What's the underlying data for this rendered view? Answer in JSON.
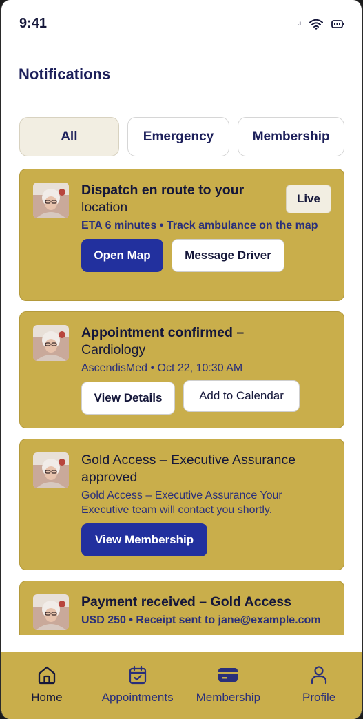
{
  "status_bar": {
    "time": "9:41",
    "signal_text": ".ı"
  },
  "header": {
    "title": "Notifications"
  },
  "tabs": [
    {
      "label": "All",
      "active": true
    },
    {
      "label": "Emergency",
      "active": false
    },
    {
      "label": "Membership",
      "active": false
    }
  ],
  "notifications": [
    {
      "title_bold": "Dispatch en route to your",
      "title_rest": "location",
      "subtitle": "ETA 6 minutes • Track ambulance on the map",
      "badge": "Live",
      "actions": [
        "Open Map",
        "Message Driver"
      ]
    },
    {
      "title_bold": "Appointment confirmed –",
      "title_rest": "Cardiology",
      "subtitle": "AscendisMed • Oct 22, 10:30 AM",
      "actions": [
        "View Details",
        "Add to Calendar"
      ]
    },
    {
      "title": "Gold Access – Executive Assurance approved",
      "subtitle": "Gold Access – Executive Assurance Your Executive team will contact you shortly.",
      "actions": [
        "View Membership"
      ]
    },
    {
      "title_bold": "Payment received – Gold Access",
      "subtitle": "USD 250 • Receipt sent to jane@example.com"
    }
  ],
  "bottom_nav": [
    {
      "label": "Home",
      "icon": "home-icon",
      "active": true
    },
    {
      "label": "Appointments",
      "icon": "calendar-icon",
      "active": false
    },
    {
      "label": "Membership",
      "icon": "card-icon",
      "active": false
    },
    {
      "label": "Profile",
      "icon": "person-icon",
      "active": false
    }
  ],
  "colors": {
    "card_bg": "#c9ae4b",
    "primary": "#22309e",
    "text_dark": "#15173a",
    "text_sub": "#2a2f7a"
  }
}
